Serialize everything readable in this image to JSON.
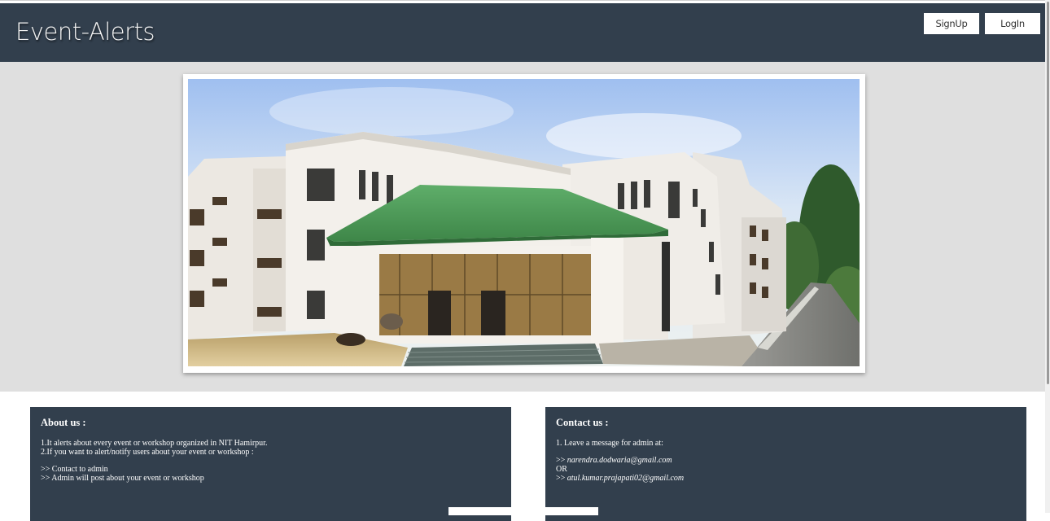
{
  "header": {
    "brand": "Event-Alerts",
    "signup_label": "SignUp",
    "login_label": "LogIn"
  },
  "hero": {
    "image_alt": "campus building"
  },
  "about": {
    "title": "About us :",
    "line1": "1.It alerts about every event or workshop organized in NIT Hamirpur.",
    "line2": "2.If you want to alert/notify users about your event or workshop :",
    "line3": ">> Contact to admin",
    "line4": ">> Admin will post about your event or workshop"
  },
  "contact": {
    "title": "Contact us :",
    "line1": "1. Leave a message for admin at:",
    "prefix": ">> ",
    "email1": "narendra.dodwaria@gmail.com",
    "or": "OR",
    "email2": "atul.kumar.prajapati02@gmail.com"
  },
  "colors": {
    "header_bg": "#323f4d",
    "hero_bg": "#dfdfdf",
    "roof_green": "#4f9a5a"
  }
}
